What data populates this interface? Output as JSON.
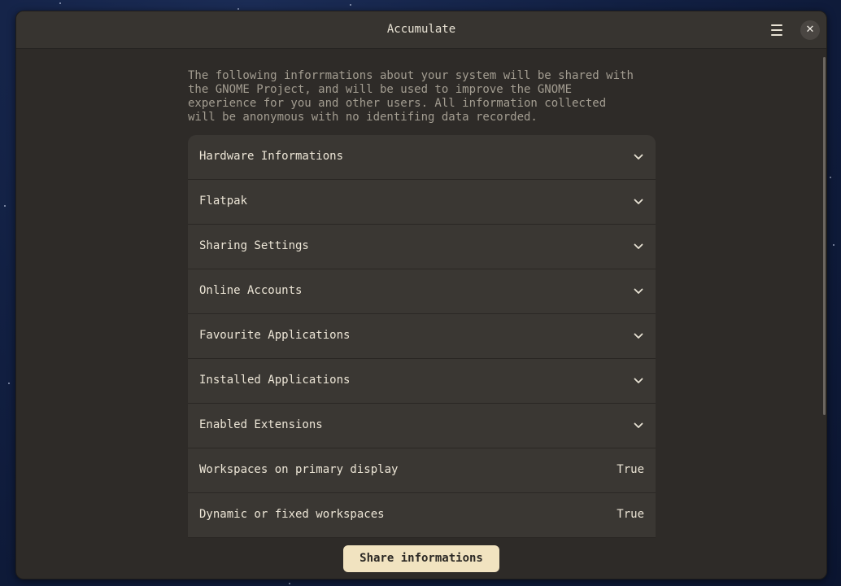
{
  "window": {
    "title": "Accumulate"
  },
  "header": {
    "menu_icon": "hamburger-menu-icon",
    "close_icon": "close-icon",
    "close_glyph": "✕"
  },
  "intro": {
    "text": "The following inforrmations about your system will be shared with\nthe GNOME Project, and will be used to improve the GNOME\nexperience for you and other users. All information collected\nwill be anonymous with no identifing data recorded."
  },
  "rows": [
    {
      "label": "Hardware Informations",
      "type": "expander"
    },
    {
      "label": "Flatpak",
      "type": "expander"
    },
    {
      "label": "Sharing Settings",
      "type": "expander"
    },
    {
      "label": "Online Accounts",
      "type": "expander"
    },
    {
      "label": "Favourite Applications",
      "type": "expander"
    },
    {
      "label": "Installed Applications",
      "type": "expander"
    },
    {
      "label": "Enabled Extensions",
      "type": "expander"
    },
    {
      "label": "Workspaces on primary display",
      "type": "value",
      "value": "True"
    },
    {
      "label": "Dynamic or fixed workspaces",
      "type": "value",
      "value": "True"
    }
  ],
  "footer": {
    "share_label": "Share informations"
  },
  "colors": {
    "accent_button": "#f1e3c0",
    "window_bg": "#2e2b28",
    "row_bg": "#3a3733"
  }
}
